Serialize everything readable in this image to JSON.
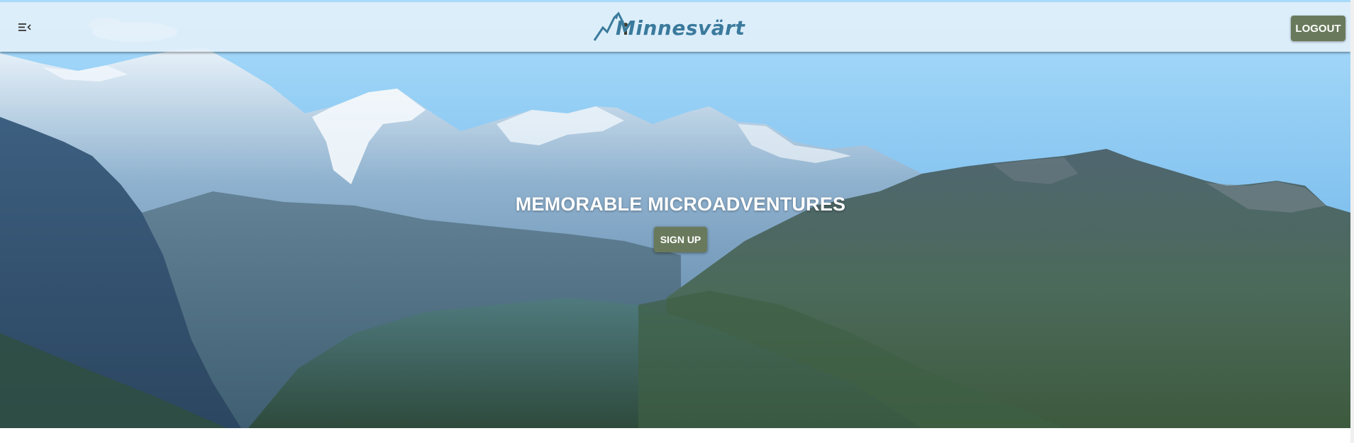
{
  "header": {
    "menu_icon": "menu-collapse-icon",
    "logo_text": "Minnesvärt",
    "logo_icon": "mountain-hiker-icon",
    "logout_label": "LOGOUT"
  },
  "hero": {
    "title": "MEMORABLE MICROADVENTURES",
    "signup_label": "SIGN UP",
    "background": "alpine-mountain-landscape"
  },
  "colors": {
    "button": "#697a5c",
    "logo": "#3a7a9c",
    "header_bg": "#e2effa"
  }
}
